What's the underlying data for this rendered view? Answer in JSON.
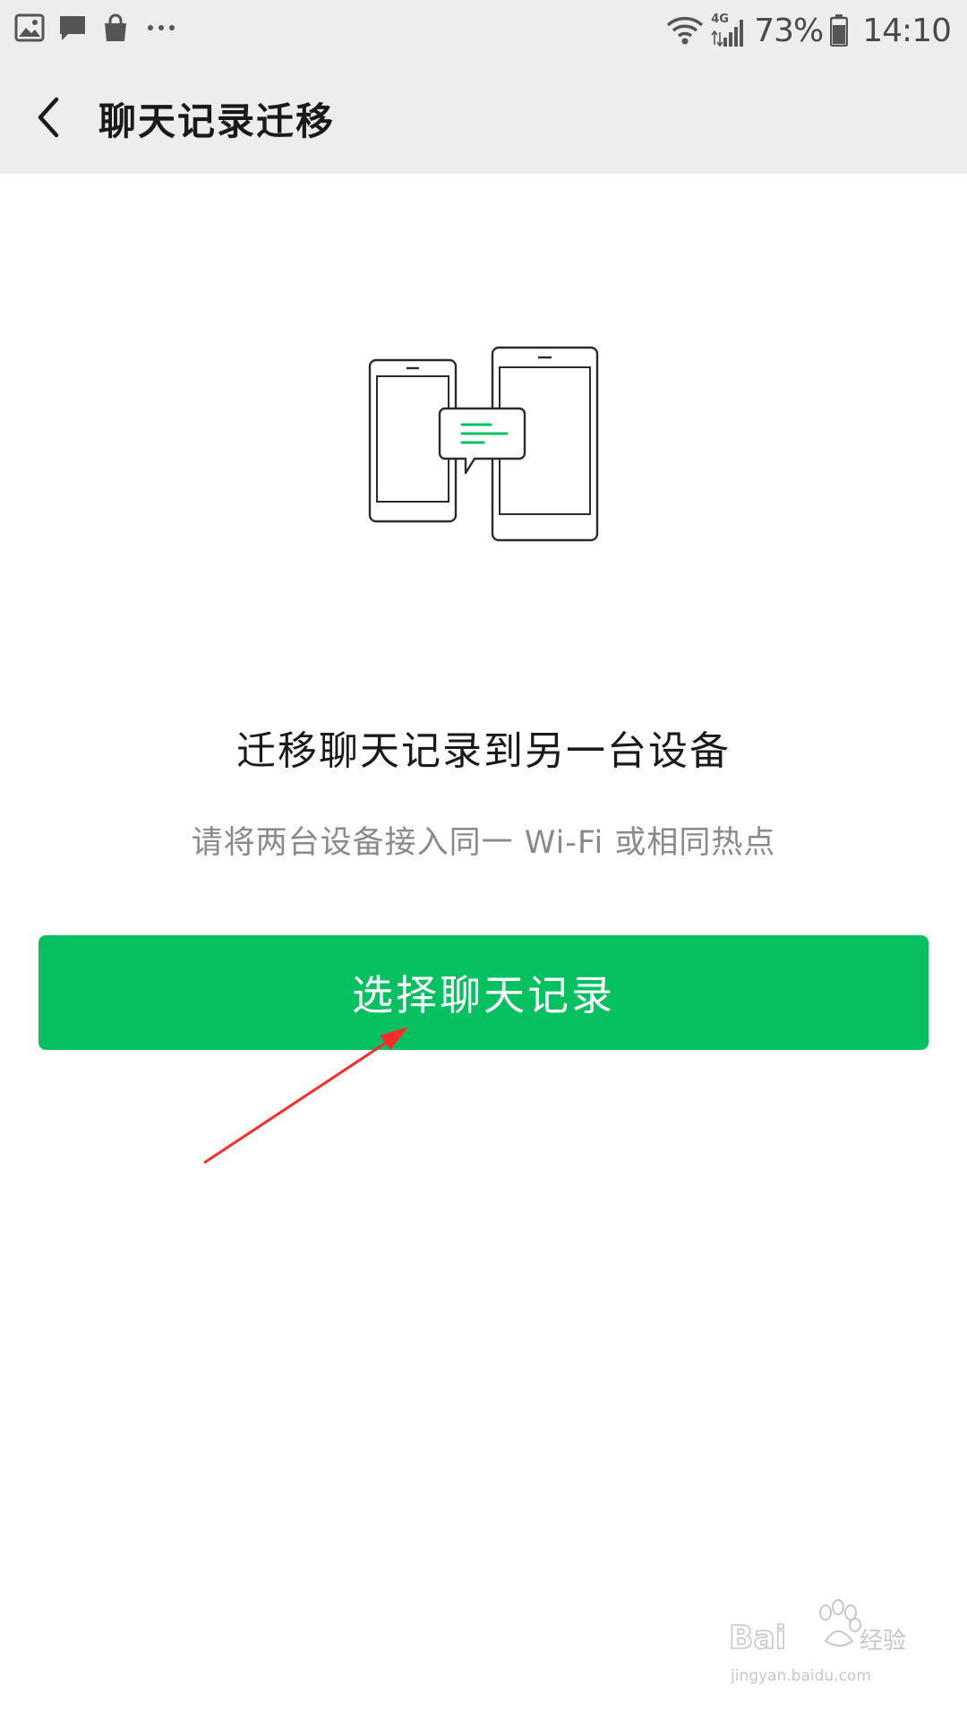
{
  "status_bar": {
    "left_icons": [
      "gallery-icon",
      "message-icon",
      "shopping-bag-icon",
      "more-icon"
    ],
    "network_label": "4G",
    "battery": "73%",
    "time": "14:10"
  },
  "header": {
    "title": "聊天记录迁移",
    "back_icon": "chevron-left-icon"
  },
  "main": {
    "illustration_icon": "two-phones-chat-transfer-icon",
    "heading": "迁移聊天记录到另一台设备",
    "subtext": "请将两台设备接入同一 Wi-Fi 或相同热点",
    "primary_button_label": "选择聊天记录"
  },
  "watermark": {
    "brand": "Baidu",
    "brand_suffix": "经验",
    "url": "jingyan.baidu.com"
  },
  "colors": {
    "accent": "#07c160",
    "header_bg": "#ededed",
    "annotation_arrow": "#ff2a2a"
  }
}
